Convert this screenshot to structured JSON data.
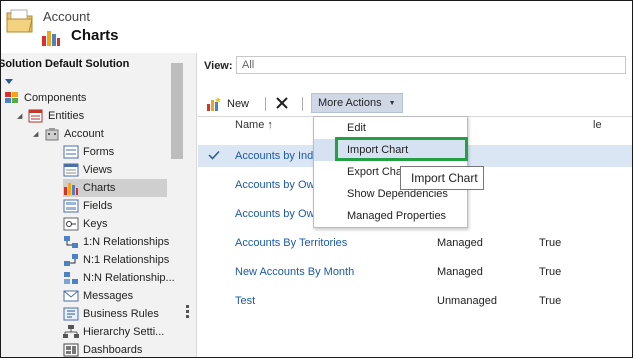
{
  "header": {
    "entity": "Account",
    "title": "Charts"
  },
  "nav": {
    "solution_label": "Solution Default Solution",
    "items": [
      {
        "label": "Components",
        "icon": "components-icon"
      },
      {
        "label": "Entities",
        "icon": "entities-icon"
      },
      {
        "label": "Account",
        "icon": "account-icon"
      },
      {
        "label": "Forms",
        "icon": "forms-icon"
      },
      {
        "label": "Views",
        "icon": "views-icon"
      },
      {
        "label": "Charts",
        "icon": "charts-icon"
      },
      {
        "label": "Fields",
        "icon": "fields-icon"
      },
      {
        "label": "Keys",
        "icon": "keys-icon"
      },
      {
        "label": "1:N Relationships",
        "icon": "relationship-icon"
      },
      {
        "label": "N:1 Relationships",
        "icon": "relationship-icon"
      },
      {
        "label": "N:N Relationship...",
        "icon": "relationship-icon"
      },
      {
        "label": "Messages",
        "icon": "messages-icon"
      },
      {
        "label": "Business Rules",
        "icon": "business-rules-icon"
      },
      {
        "label": "Hierarchy Setti...",
        "icon": "hierarchy-icon"
      },
      {
        "label": "Dashboards",
        "icon": "dashboards-icon"
      }
    ]
  },
  "view": {
    "label": "View:",
    "value": "All"
  },
  "toolbar": {
    "new_label": "New",
    "more_actions_label": "More Actions"
  },
  "grid": {
    "columns": [
      "Name ↑",
      "le"
    ],
    "rows": [
      {
        "name": "Accounts by Ind",
        "state": "",
        "custom": "",
        "selected": true
      },
      {
        "name": "Accounts by Ow",
        "state": "",
        "custom": "",
        "selected": false
      },
      {
        "name": "Accounts by Ow",
        "state": "",
        "custom": "",
        "selected": false
      },
      {
        "name": "Accounts By Territories",
        "state": "Managed",
        "custom": "True",
        "selected": false
      },
      {
        "name": "New Accounts By Month",
        "state": "Managed",
        "custom": "True",
        "selected": false
      },
      {
        "name": "Test",
        "state": "Unmanaged",
        "custom": "True",
        "selected": false
      }
    ]
  },
  "more_actions_menu": {
    "items": [
      "Edit",
      "Import Chart",
      "Export Char",
      "Show Dependencies",
      "Managed Properties"
    ],
    "hovered_index": 1
  },
  "tooltip": "Import Chart",
  "colors": {
    "link": "#1c5aa8",
    "selection": "#dbe6f4",
    "highlight_box": "#22a043",
    "more_actions_bg": "#d0d8e6"
  }
}
